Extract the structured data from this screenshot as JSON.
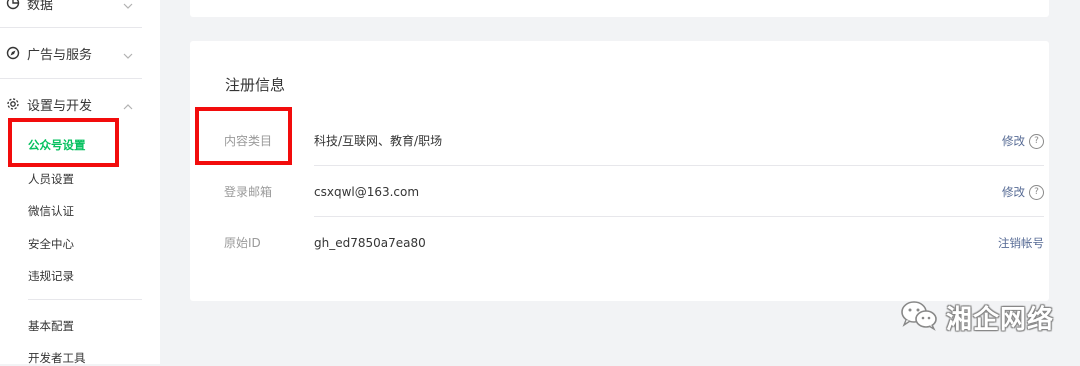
{
  "sidebar": {
    "groups": [
      {
        "label": "数据",
        "icon": "chart-pie-icon",
        "expanded": false
      },
      {
        "label": "广告与服务",
        "icon": "compass-icon",
        "expanded": false
      },
      {
        "label": "设置与开发",
        "icon": "gear-icon",
        "expanded": true
      }
    ],
    "items": [
      {
        "label": "公众号设置",
        "active": true
      },
      {
        "label": "人员设置"
      },
      {
        "label": "微信认证"
      },
      {
        "label": "安全中心"
      },
      {
        "label": "违规记录"
      },
      {
        "label": "基本配置"
      },
      {
        "label": "开发者工具"
      }
    ]
  },
  "registration": {
    "title": "注册信息",
    "rows": [
      {
        "label": "内容类目",
        "value": "科技/互联网、教育/职场",
        "action": "修改",
        "help_icon": "question-circle-icon"
      },
      {
        "label": "登录邮箱",
        "value": "csxqwl@163.com",
        "action": "修改",
        "help_icon": "question-circle-icon"
      },
      {
        "label": "原始ID",
        "value": "gh_ed7850a7ea80",
        "action": "注销帐号"
      }
    ]
  },
  "watermark": {
    "text": "湘企网络",
    "icon": "wechat-icon"
  },
  "colors": {
    "active_green": "#07c160",
    "link_blue": "#576b95",
    "highlight_red": "#f20c0c",
    "background": "#f2f3f5"
  }
}
